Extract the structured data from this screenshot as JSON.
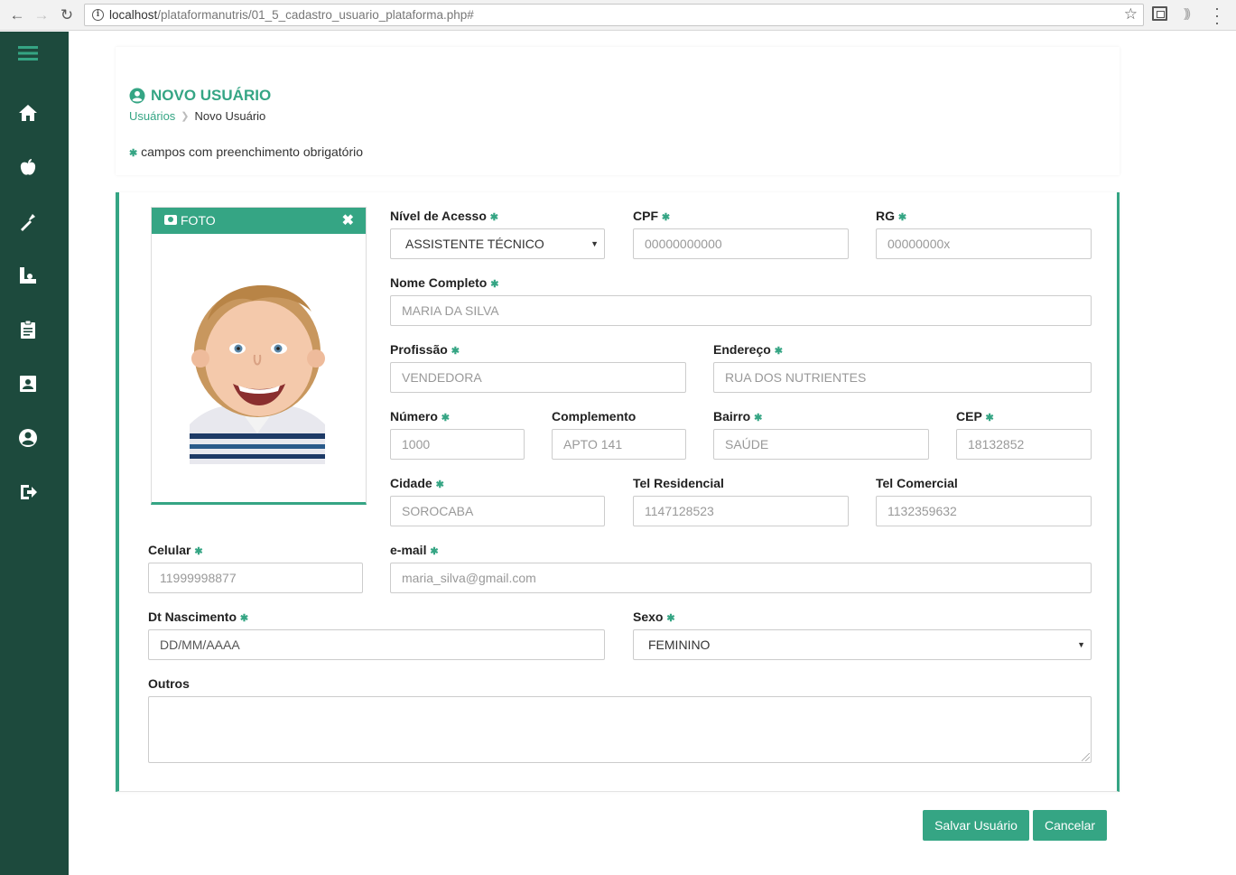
{
  "browser": {
    "url_host": "localhost",
    "url_path": "/plataformanutris/01_5_cadastro_usuario_plataforma.php#"
  },
  "sidebar": {
    "items": [
      {
        "icon": "menu-icon"
      },
      {
        "icon": "home-icon"
      },
      {
        "icon": "apple-icon"
      },
      {
        "icon": "utensils-icon"
      },
      {
        "icon": "ruler-icon"
      },
      {
        "icon": "clipboard-icon"
      },
      {
        "icon": "contact-card-icon"
      },
      {
        "icon": "user-circle-icon"
      },
      {
        "icon": "sign-out-icon"
      }
    ]
  },
  "header": {
    "title": "NOVO USUÁRIO",
    "breadcrumb": {
      "parent": "Usuários",
      "current": "Novo Usuário"
    },
    "required_note": "campos com preenchimento obrigatório",
    "required_symbol": "✱"
  },
  "photo": {
    "label": "FOTO",
    "close": "✖"
  },
  "form": {
    "nivel_acesso": {
      "label": "Nível de Acesso",
      "value": "ASSISTENTE TÉCNICO"
    },
    "cpf": {
      "label": "CPF",
      "placeholder": "00000000000"
    },
    "rg": {
      "label": "RG",
      "placeholder": "00000000x"
    },
    "nome": {
      "label": "Nome Completo",
      "placeholder": "MARIA DA SILVA"
    },
    "profissao": {
      "label": "Profissão",
      "placeholder": "VENDEDORA"
    },
    "endereco": {
      "label": "Endereço",
      "placeholder": "RUA DOS NUTRIENTES"
    },
    "numero": {
      "label": "Número",
      "placeholder": "1000"
    },
    "complemento": {
      "label": "Complemento",
      "placeholder": "APTO 141"
    },
    "bairro": {
      "label": "Bairro",
      "placeholder": "SAÚDE"
    },
    "cep": {
      "label": "CEP",
      "placeholder": "18132852"
    },
    "cidade": {
      "label": "Cidade",
      "placeholder": "SOROCABA"
    },
    "tel_residencial": {
      "label": "Tel Residencial",
      "placeholder": "1147128523"
    },
    "tel_comercial": {
      "label": "Tel Comercial",
      "placeholder": "1132359632"
    },
    "celular": {
      "label": "Celular",
      "placeholder": "11999998877"
    },
    "email": {
      "label": "e-mail",
      "placeholder": "maria_silva@gmail.com"
    },
    "nascimento": {
      "label": "Dt Nascimento",
      "placeholder": "DD/MM/AAAA"
    },
    "sexo": {
      "label": "Sexo",
      "value": "FEMININO"
    },
    "outros": {
      "label": "Outros"
    }
  },
  "actions": {
    "save": "Salvar Usuário",
    "cancel": "Cancelar"
  },
  "colors": {
    "accent": "#35a584",
    "sidebar": "#1d4a3d"
  }
}
